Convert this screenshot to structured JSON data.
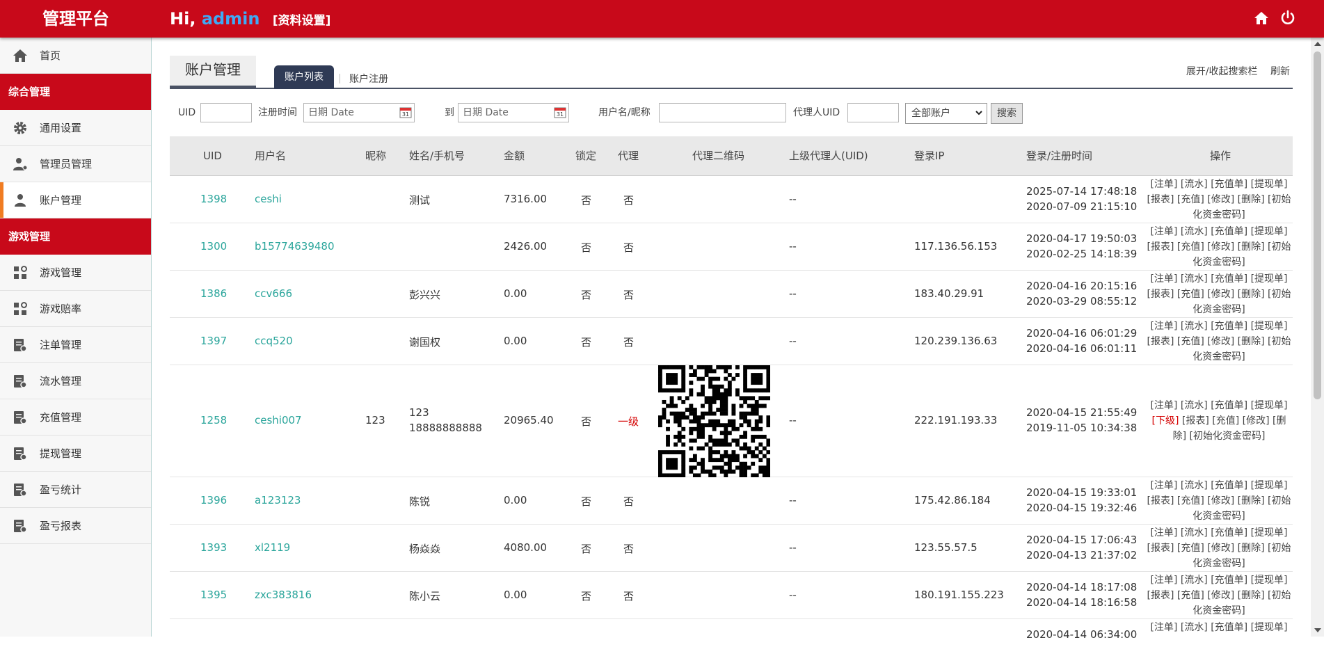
{
  "header": {
    "brand": "管理平台",
    "greet_prefix": "Hi, ",
    "username": "admin",
    "profile_link": "[资料设置]",
    "icons": [
      "home-icon",
      "power-icon"
    ],
    "color": "#c8091a"
  },
  "sidebar": {
    "home": "首页",
    "section_general": "综合管理",
    "general_items": [
      "通用设置",
      "管理员管理",
      "账户管理"
    ],
    "section_game": "游戏管理",
    "game_items": [
      "游戏管理",
      "游戏赔率",
      "注单管理",
      "流水管理",
      "充值管理",
      "提现管理",
      "盈亏统计",
      "盈亏报表"
    ],
    "active": "账户管理"
  },
  "page": {
    "title": "账户管理",
    "tab_list": "账户列表",
    "tab_register": "账户注册",
    "toggle_search": "展开/收起搜索栏",
    "refresh": "刷新"
  },
  "search": {
    "uid_label": "UID",
    "reg_time_label": "注册时间",
    "date_placeholder": "日期 Date",
    "to_label": "到",
    "name_label": "用户名/昵称",
    "agent_uid_label": "代理人UID",
    "account_filter": "全部账户",
    "search_button": "搜索"
  },
  "table": {
    "headers": [
      "UID",
      "用户名",
      "昵称",
      "姓名/手机号",
      "金额",
      "锁定",
      "代理",
      "代理二维码",
      "上级代理人(UID)",
      "登录IP",
      "登录/注册时间",
      "操作"
    ],
    "ops_normal": "[注单] [流水] [充值单] [提现单] [报表] [充值] [修改] [删除] [初始化资金密码]",
    "ops_agent_a": "[注单] [流水] [充值单] [提现单]",
    "ops_agent_sub": "[下级]",
    "ops_agent_b": " [报表] [充值] [修改] [删除] [初始化资金密码]",
    "rows": [
      {
        "uid": "1398",
        "username": "ceshi",
        "nickname": "",
        "name": "测试",
        "phone": "",
        "amount": "7316.00",
        "locked": "否",
        "agent": "否",
        "parent": "--",
        "ip": "",
        "login": "2025-07-14 17:48:18",
        "reg": "2020-07-09 21:15:10"
      },
      {
        "uid": "1300",
        "username": "b15774639480",
        "nickname": "",
        "name": "",
        "phone": "",
        "amount": "2426.00",
        "locked": "否",
        "agent": "否",
        "parent": "--",
        "ip": "117.136.56.153",
        "login": "2020-04-17 19:50:03",
        "reg": "2020-02-25 14:18:39"
      },
      {
        "uid": "1386",
        "username": "ccv666",
        "nickname": "",
        "name": "彭兴兴",
        "phone": "",
        "amount": "0.00",
        "locked": "否",
        "agent": "否",
        "parent": "--",
        "ip": "183.40.29.91",
        "login": "2020-04-16 20:15:16",
        "reg": "2020-03-29 08:55:12"
      },
      {
        "uid": "1397",
        "username": "ccq520",
        "nickname": "",
        "name": "谢国权",
        "phone": "",
        "amount": "0.00",
        "locked": "否",
        "agent": "否",
        "parent": "--",
        "ip": "120.239.136.63",
        "login": "2020-04-16 06:01:29",
        "reg": "2020-04-16 06:01:11"
      },
      {
        "uid": "1258",
        "username": "ceshi007",
        "nickname": "123",
        "name": "123",
        "phone": "18888888888",
        "amount": "20965.40",
        "locked": "否",
        "agent": "一级",
        "parent": "--",
        "ip": "222.191.193.33",
        "login": "2020-04-15 21:55:49",
        "reg": "2019-11-05 10:34:38"
      },
      {
        "uid": "1396",
        "username": "a123123",
        "nickname": "",
        "name": "陈锐",
        "phone": "",
        "amount": "0.00",
        "locked": "否",
        "agent": "否",
        "parent": "--",
        "ip": "175.42.86.184",
        "login": "2020-04-15 19:33:01",
        "reg": "2020-04-15 19:32:46"
      },
      {
        "uid": "1393",
        "username": "xl2119",
        "nickname": "",
        "name": "杨焱焱",
        "phone": "",
        "amount": "4080.00",
        "locked": "否",
        "agent": "否",
        "parent": "--",
        "ip": "123.55.57.5",
        "login": "2020-04-15 17:06:43",
        "reg": "2020-04-13 21:37:02"
      },
      {
        "uid": "1395",
        "username": "zxc383816",
        "nickname": "",
        "name": "陈小云",
        "phone": "",
        "amount": "0.00",
        "locked": "否",
        "agent": "否",
        "parent": "--",
        "ip": "180.191.155.223",
        "login": "2020-04-14 18:17:08",
        "reg": "2020-04-14 18:16:58"
      }
    ],
    "partial_row": {
      "login": "2020-04-14 06:34:00",
      "ops": "[注单] [流水] [充值单] [提现单]"
    }
  }
}
